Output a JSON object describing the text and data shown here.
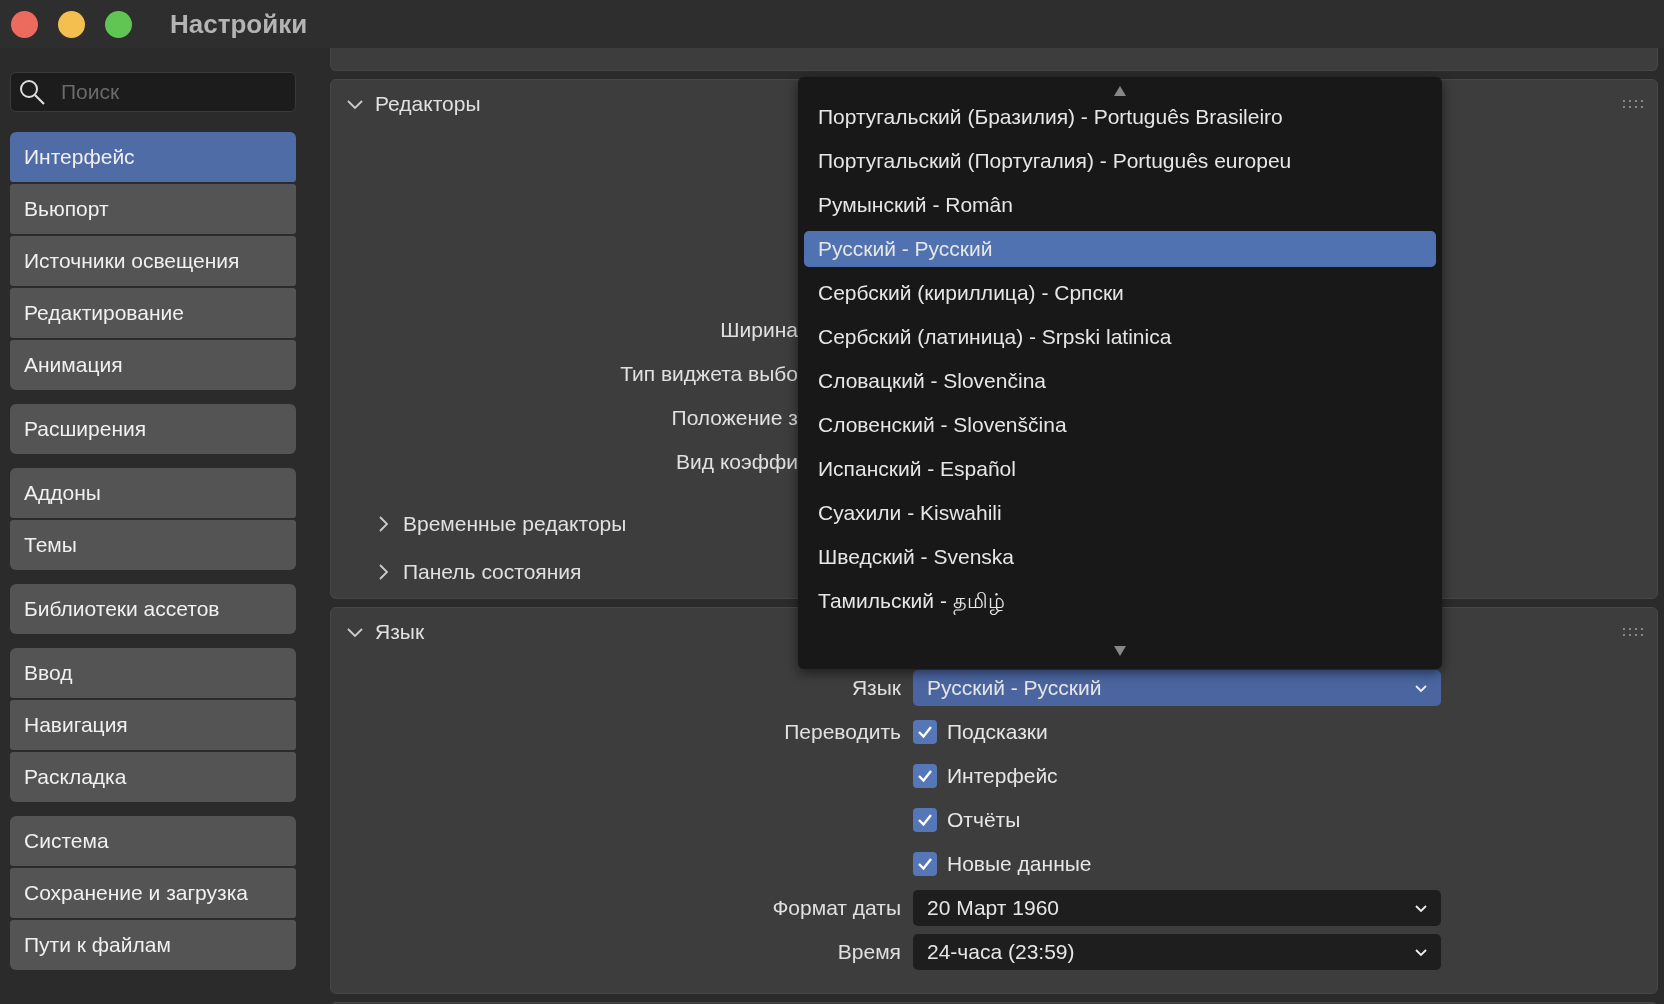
{
  "window": {
    "title": "Настройки"
  },
  "search": {
    "placeholder": "Поиск"
  },
  "sidebar": {
    "groups": [
      {
        "items": [
          {
            "label": "Интерфейс",
            "selected": true
          },
          {
            "label": "Вьюпорт",
            "selected": false
          },
          {
            "label": "Источники освещения",
            "selected": false
          },
          {
            "label": "Редактирование",
            "selected": false
          },
          {
            "label": "Анимация",
            "selected": false
          }
        ]
      },
      {
        "items": [
          {
            "label": "Расширения",
            "selected": false
          }
        ]
      },
      {
        "items": [
          {
            "label": "Аддоны",
            "selected": false
          },
          {
            "label": "Темы",
            "selected": false
          }
        ]
      },
      {
        "items": [
          {
            "label": "Библиотеки ассетов",
            "selected": false
          }
        ]
      },
      {
        "items": [
          {
            "label": "Ввод",
            "selected": false
          },
          {
            "label": "Навигация",
            "selected": false
          },
          {
            "label": "Раскладка",
            "selected": false
          }
        ]
      },
      {
        "items": [
          {
            "label": "Система",
            "selected": false
          },
          {
            "label": "Сохранение и загрузка",
            "selected": false
          },
          {
            "label": "Пути к файлам",
            "selected": false
          }
        ]
      }
    ]
  },
  "editors_panel": {
    "title": "Редакторы",
    "expanded": true,
    "fields": [
      {
        "label": "Ширина"
      },
      {
        "label": "Тип виджета выбо"
      },
      {
        "label": "Положение з"
      },
      {
        "label": "Вид коэффи"
      }
    ],
    "subpanels": [
      {
        "title": "Временные редакторы",
        "expanded": false
      },
      {
        "title": "Панель состояния",
        "expanded": false
      }
    ]
  },
  "language_panel": {
    "title": "Язык",
    "expanded": true,
    "language": {
      "label": "Язык",
      "value": "Русский - Русский"
    },
    "translate": {
      "label": "Переводить",
      "options": [
        {
          "label": "Подсказки",
          "checked": true
        },
        {
          "label": "Интерфейс",
          "checked": true
        },
        {
          "label": "Отчёты",
          "checked": true
        },
        {
          "label": "Новые данные",
          "checked": true
        }
      ]
    },
    "date_format": {
      "label": "Формат даты",
      "value": "20 Март 1960"
    },
    "time": {
      "label": "Время",
      "value": "24-часа (23:59)"
    }
  },
  "language_menu": {
    "items": [
      {
        "label": "Португальский (Бразилия) - Português Brasileiro",
        "selected": false
      },
      {
        "label": "Португальский (Португалия) - Português europeu",
        "selected": false
      },
      {
        "label": "Румынский - Român",
        "selected": false
      },
      {
        "label": "Русский - Русский",
        "selected": true
      },
      {
        "label": "Сербский (кириллица) - Српски",
        "selected": false
      },
      {
        "label": "Сербский (латиница) - Srpski latinica",
        "selected": false
      },
      {
        "label": "Словацкий - Slovenčina",
        "selected": false
      },
      {
        "label": "Словенский - Slovenščina",
        "selected": false
      },
      {
        "label": "Испанский - Español",
        "selected": false
      },
      {
        "label": "Суахили - Kiswahili",
        "selected": false
      },
      {
        "label": "Шведский - Svenska",
        "selected": false
      },
      {
        "label": "Тамильский - தமிழ்",
        "selected": false
      }
    ]
  }
}
